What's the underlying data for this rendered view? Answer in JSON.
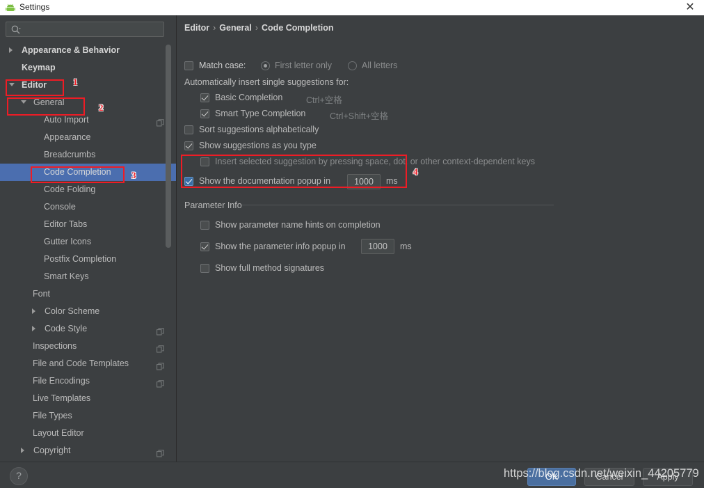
{
  "window": {
    "title": "Settings",
    "app_icon": "android-icon",
    "close_label": "✕"
  },
  "sidebar": {
    "search": {
      "placeholder": "",
      "value": "",
      "icon": "search-icon"
    },
    "items": [
      {
        "label": "Appearance & Behavior",
        "indent": 14,
        "arrow": "right",
        "bold": true,
        "selected": false,
        "copy": false
      },
      {
        "label": "Keymap",
        "indent": 31,
        "arrow": "none",
        "bold": true,
        "selected": false,
        "copy": false
      },
      {
        "label": "Editor",
        "indent": 14,
        "arrow": "down",
        "bold": true,
        "selected": false,
        "copy": false
      },
      {
        "label": "General",
        "indent": 31,
        "arrow": "down",
        "bold": false,
        "selected": false,
        "copy": false
      },
      {
        "label": "Auto Import",
        "indent": 63,
        "arrow": "none",
        "bold": false,
        "selected": false,
        "copy": true
      },
      {
        "label": "Appearance",
        "indent": 63,
        "arrow": "none",
        "bold": false,
        "selected": false,
        "copy": false
      },
      {
        "label": "Breadcrumbs",
        "indent": 63,
        "arrow": "none",
        "bold": false,
        "selected": false,
        "copy": false
      },
      {
        "label": "Code Completion",
        "indent": 63,
        "arrow": "none",
        "bold": false,
        "selected": true,
        "copy": false
      },
      {
        "label": "Code Folding",
        "indent": 63,
        "arrow": "none",
        "bold": false,
        "selected": false,
        "copy": false
      },
      {
        "label": "Console",
        "indent": 63,
        "arrow": "none",
        "bold": false,
        "selected": false,
        "copy": false
      },
      {
        "label": "Editor Tabs",
        "indent": 63,
        "arrow": "none",
        "bold": false,
        "selected": false,
        "copy": false
      },
      {
        "label": "Gutter Icons",
        "indent": 63,
        "arrow": "none",
        "bold": false,
        "selected": false,
        "copy": false
      },
      {
        "label": "Postfix Completion",
        "indent": 63,
        "arrow": "none",
        "bold": false,
        "selected": false,
        "copy": false
      },
      {
        "label": "Smart Keys",
        "indent": 63,
        "arrow": "none",
        "bold": false,
        "selected": false,
        "copy": false
      },
      {
        "label": "Font",
        "indent": 47,
        "arrow": "none",
        "bold": false,
        "selected": false,
        "copy": false
      },
      {
        "label": "Color Scheme",
        "indent": 47,
        "arrow": "right",
        "bold": false,
        "selected": false,
        "copy": false
      },
      {
        "label": "Code Style",
        "indent": 47,
        "arrow": "right",
        "bold": false,
        "selected": false,
        "copy": true
      },
      {
        "label": "Inspections",
        "indent": 47,
        "arrow": "none",
        "bold": false,
        "selected": false,
        "copy": true
      },
      {
        "label": "File and Code Templates",
        "indent": 47,
        "arrow": "none",
        "bold": false,
        "selected": false,
        "copy": true
      },
      {
        "label": "File Encodings",
        "indent": 47,
        "arrow": "none",
        "bold": false,
        "selected": false,
        "copy": true
      },
      {
        "label": "Live Templates",
        "indent": 47,
        "arrow": "none",
        "bold": false,
        "selected": false,
        "copy": false
      },
      {
        "label": "File Types",
        "indent": 47,
        "arrow": "none",
        "bold": false,
        "selected": false,
        "copy": false
      },
      {
        "label": "Layout Editor",
        "indent": 47,
        "arrow": "none",
        "bold": false,
        "selected": false,
        "copy": false
      },
      {
        "label": "Copyright",
        "indent": 31,
        "arrow": "right",
        "bold": false,
        "selected": false,
        "copy": true
      }
    ]
  },
  "content": {
    "breadcrumb": {
      "parts": [
        "Editor",
        "General",
        "Code Completion"
      ],
      "separator": "›"
    },
    "match_case": {
      "label": "Match case:",
      "checked": false,
      "options": [
        {
          "label": "First letter only",
          "selected": true
        },
        {
          "label": "All letters",
          "selected": false
        }
      ]
    },
    "auto_insert_header": "Automatically insert single suggestions for:",
    "auto_insert_items": [
      {
        "label": "Basic Completion",
        "shortcut": "Ctrl+空格",
        "checked": true
      },
      {
        "label": "Smart Type Completion",
        "shortcut": "Ctrl+Shift+空格",
        "checked": true
      }
    ],
    "options": [
      {
        "label": "Sort suggestions alphabetically",
        "checked": false
      },
      {
        "label": "Show suggestions as you type",
        "checked": true
      },
      {
        "label": "Insert selected suggestion by pressing space, dot, or other context-dependent keys",
        "checked": false
      }
    ],
    "doc_popup": {
      "label": "Show the documentation popup in",
      "checked": true,
      "value": "1000",
      "unit": "ms"
    },
    "parameter_info": {
      "title": "Parameter Info",
      "name_hints": {
        "label": "Show parameter name hints on completion",
        "checked": false
      },
      "popup": {
        "label": "Show the parameter info popup in",
        "checked": true,
        "value": "1000",
        "unit": "ms"
      },
      "full_signatures": {
        "label": "Show full method signatures",
        "checked": false
      }
    }
  },
  "footer": {
    "help_label": "?",
    "ok_label": "OK",
    "cancel_label": "Cancel",
    "apply_label": "Apply"
  },
  "annotations": {
    "marker_1": "1",
    "marker_2": "2",
    "marker_3": "3",
    "marker_4": "4",
    "box_color": "#ee1c25"
  },
  "watermark": "https://blog.csdn.net/weixin_44205779"
}
